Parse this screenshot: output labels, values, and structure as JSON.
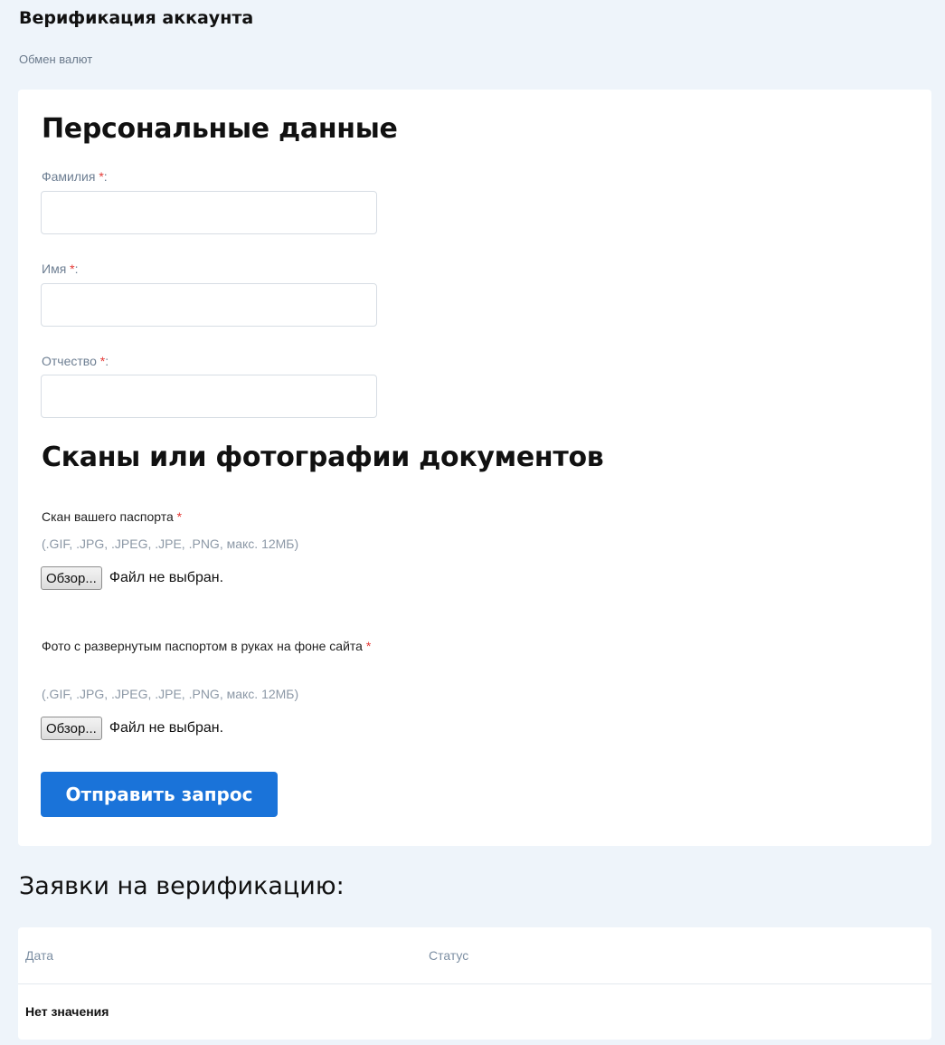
{
  "header": {
    "title": "Верификация аккаунта",
    "breadcrumb": "Обмен валют"
  },
  "personal": {
    "title": "Персональные данные",
    "required_mark": "*",
    "fields": [
      {
        "label": "Фамилия",
        "suffix": ":",
        "value": ""
      },
      {
        "label": "Имя",
        "suffix": ":",
        "value": ""
      },
      {
        "label": "Отчество",
        "suffix": ":",
        "value": ""
      }
    ]
  },
  "documents": {
    "title": "Сканы или фотографии документов",
    "uploads": [
      {
        "label": "Скан вашего паспорта",
        "hint": "(.GIF, .JPG, .JPEG, .JPE, .PNG, макс. 12МБ)",
        "button": "Обзор...",
        "status": "Файл не выбран."
      },
      {
        "label": "Фото с развернутым паспортом в руках на фоне сайта",
        "hint": "(.GIF, .JPG, .JPEG, .JPE, .PNG, макс. 12МБ)",
        "button": "Обзор...",
        "status": "Файл не выбран."
      }
    ],
    "submit_label": "Отправить запрос"
  },
  "requests": {
    "title": "Заявки на верификацию:",
    "columns": [
      "Дата",
      "Статус"
    ],
    "empty_text": "Нет значения"
  },
  "colors": {
    "accent": "#1a73d9",
    "required": "#e53935",
    "background": "#eef4fa"
  }
}
